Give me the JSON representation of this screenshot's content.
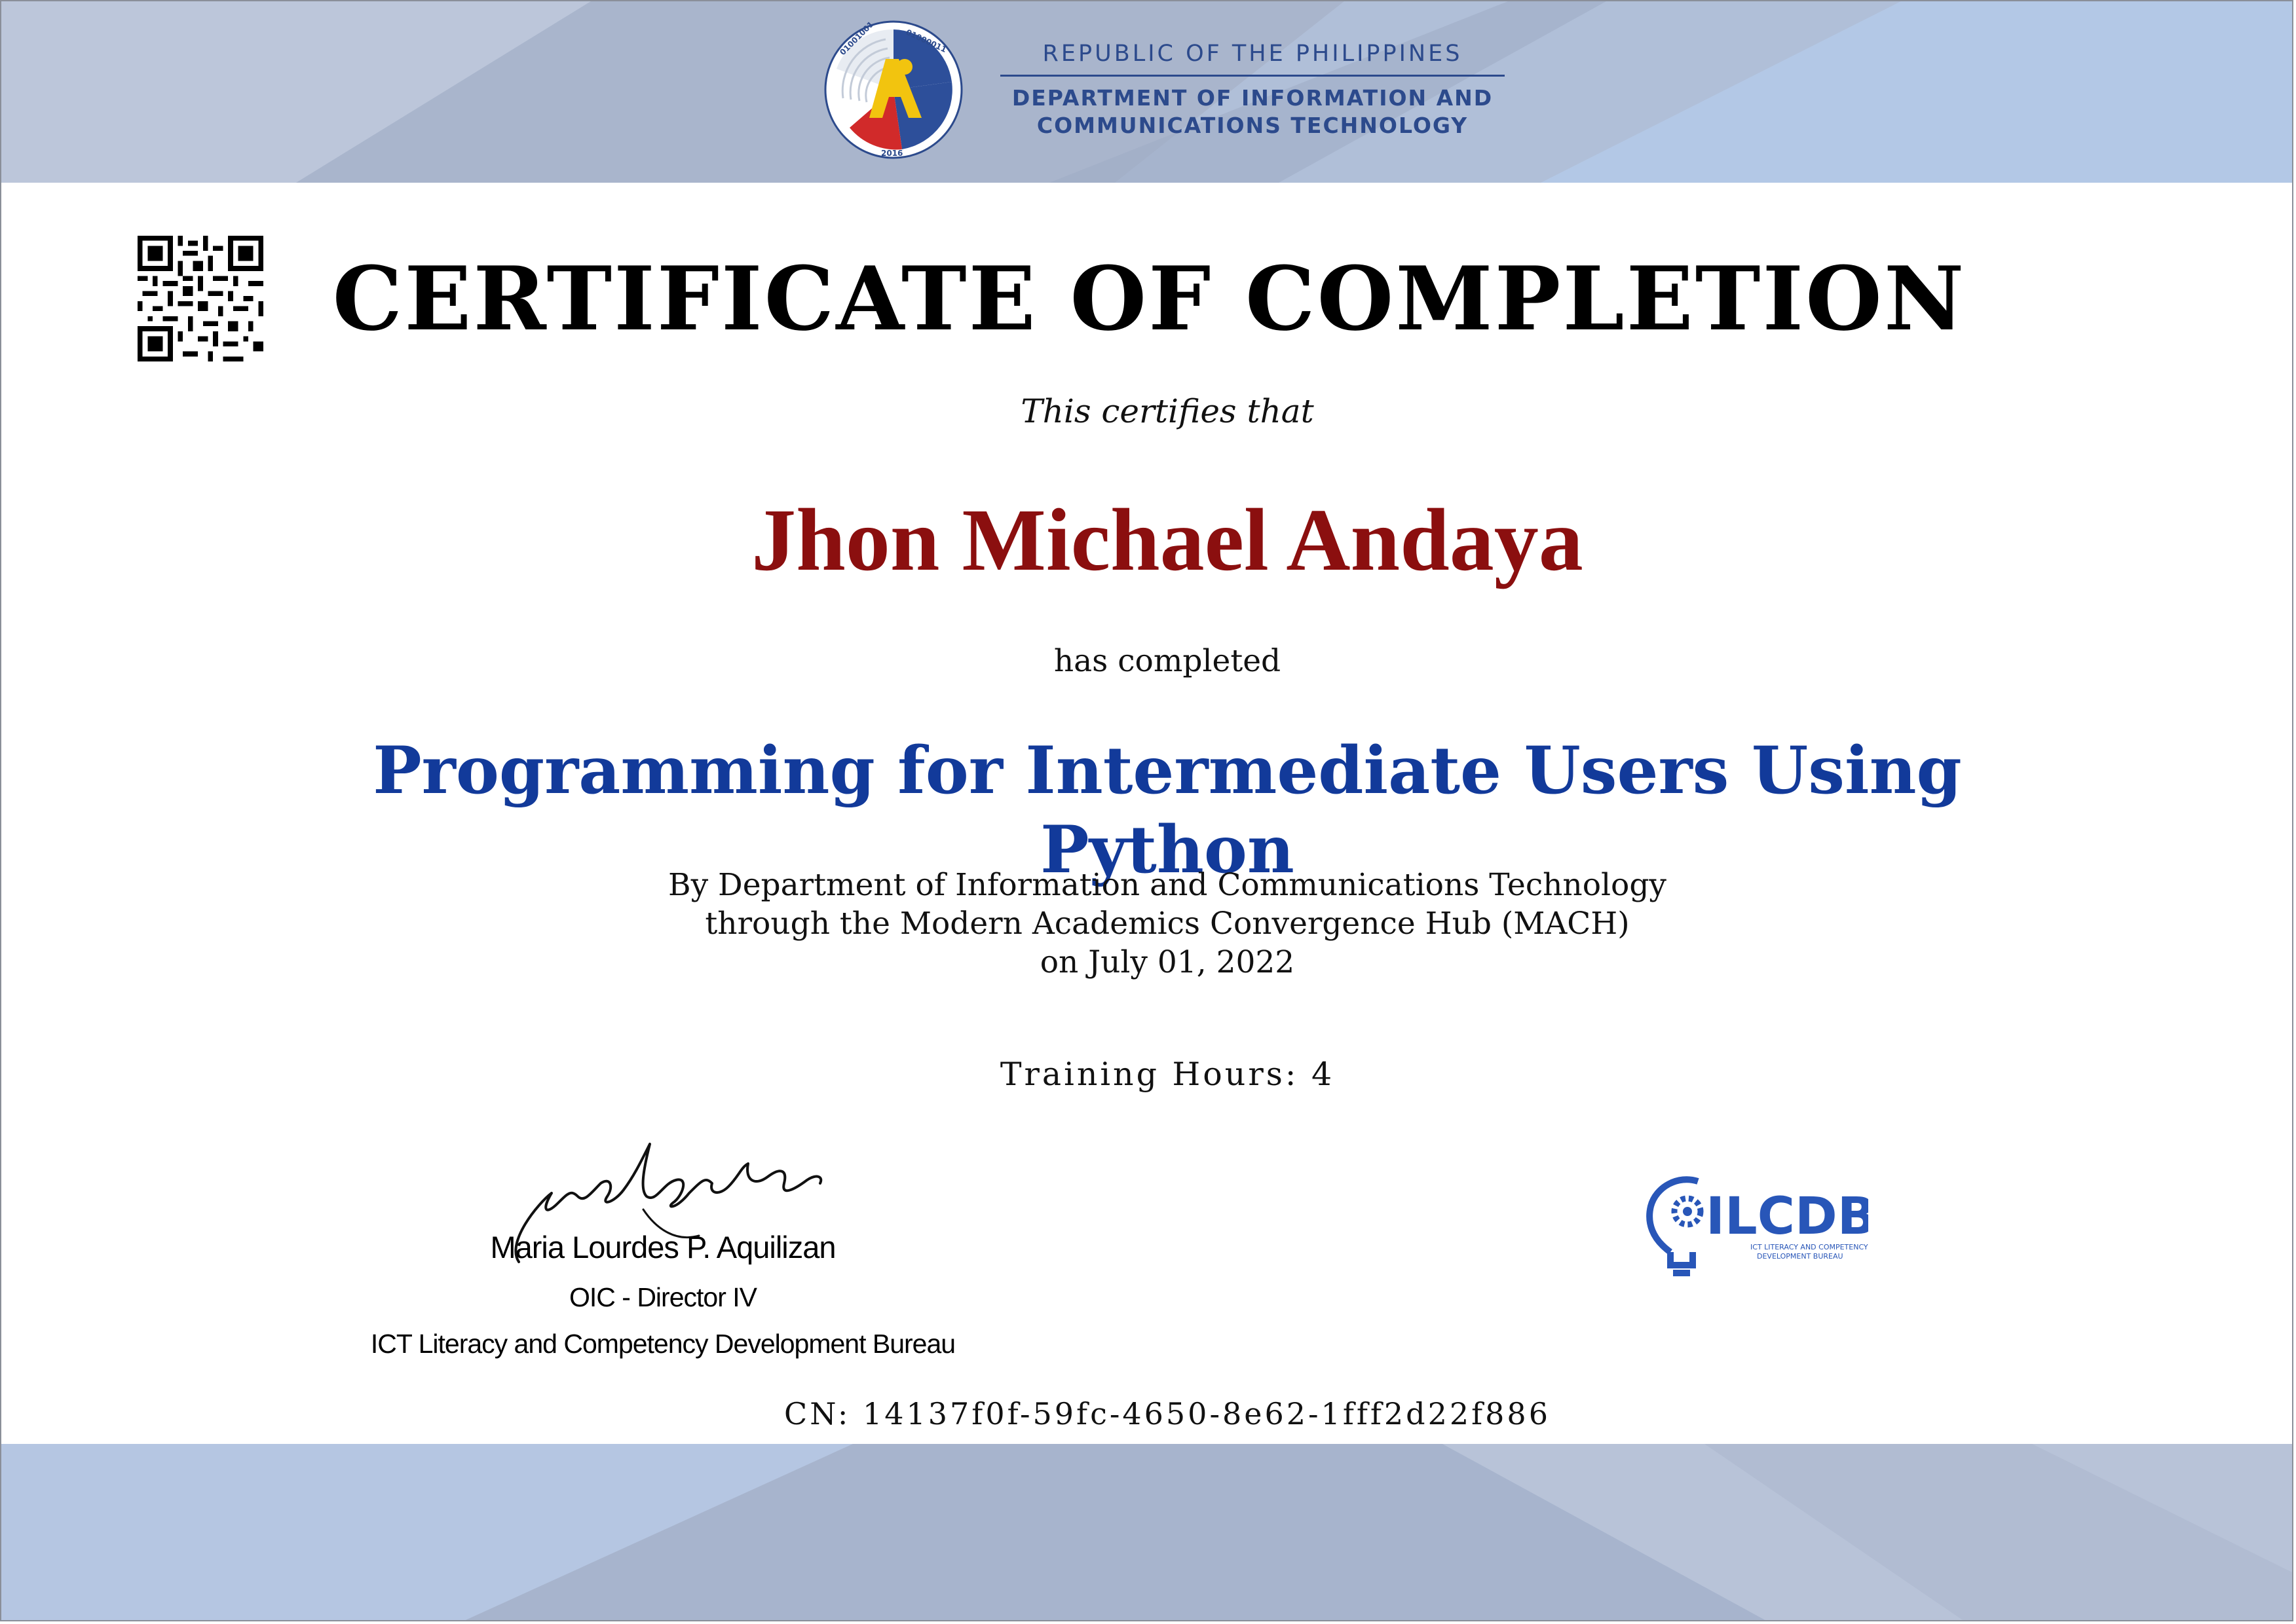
{
  "header": {
    "republic": "REPUBLIC OF THE PHILIPPINES",
    "department_line1": "DEPARTMENT OF INFORMATION AND",
    "department_line2": "COMMUNICATIONS TECHNOLOGY",
    "seal_binary_left": "01001001",
    "seal_binary_right": "01000011",
    "seal_year": "2016"
  },
  "certificate": {
    "title": "CERTIFICATE OF COMPLETION",
    "certifies": "This certifies that",
    "recipient": "Jhon Michael Andaya",
    "completed": "has completed",
    "course": "Programming for Intermediate Users Using Python",
    "by_line1": "By Department of Information and Communications Technology",
    "by_line2": "through the Modern Academics Convergence Hub (MACH)",
    "by_line3": "on July 01, 2022",
    "training_hours": "Training Hours: 4",
    "cn": "CN: 14137f0f-59fc-4650-8e62-1fff2d22f886"
  },
  "signatory": {
    "name": "Maria Lourdes P. Aquilizan",
    "role": "OIC - Director IV",
    "office": "ICT Literacy and Competency Development Bureau"
  },
  "bureau_logo": {
    "acronym": "ILCDB",
    "subtitle_line1": "ICT LITERACY AND COMPETENCY",
    "subtitle_line2": "DEVELOPMENT BUREAU"
  },
  "colors": {
    "recipient": "#8b0f0f",
    "course": "#123a9a",
    "agency_blue": "#2c4a8c",
    "band_blue": "#b4c0d6"
  }
}
